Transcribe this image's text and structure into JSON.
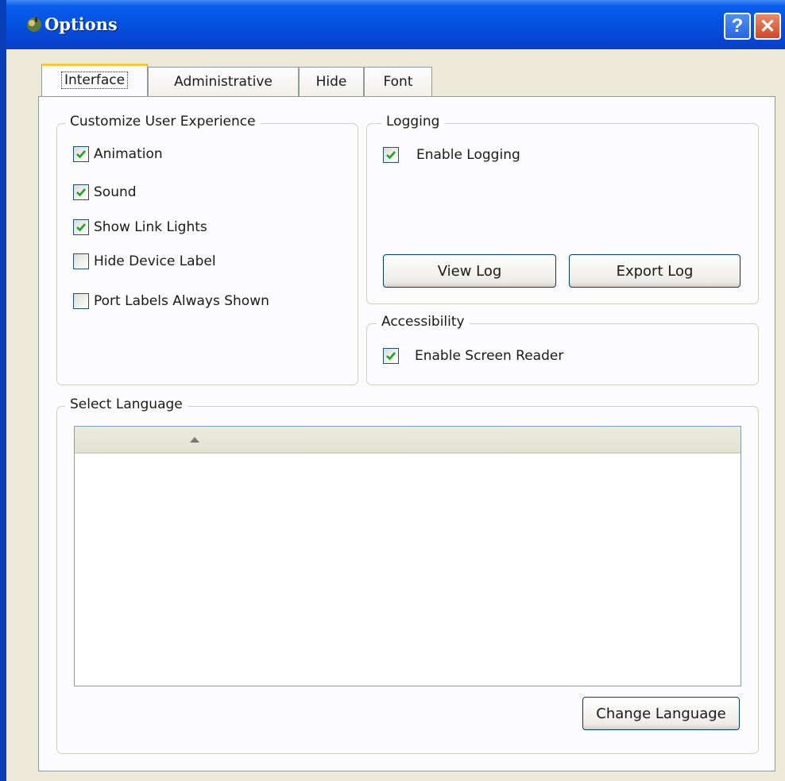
{
  "window": {
    "title": "Options",
    "help_label": "?",
    "close_label": "✕"
  },
  "tabs": [
    {
      "label": "Interface",
      "active": true
    },
    {
      "label": "Administrative"
    },
    {
      "label": "Hide"
    },
    {
      "label": "Font"
    }
  ],
  "customize": {
    "title": "Customize User Experience",
    "items": [
      {
        "label": "Animation",
        "checked": true
      },
      {
        "label": "Sound",
        "checked": true
      },
      {
        "label": "Show Link Lights",
        "checked": true
      },
      {
        "label": "Hide Device Label",
        "checked": false
      },
      {
        "label": "Port Labels Always Shown",
        "checked": false
      }
    ]
  },
  "logging": {
    "title": "Logging",
    "enable_label": "Enable Logging",
    "enable_checked": true,
    "view_log_label": "View Log",
    "export_log_label": "Export Log"
  },
  "accessibility": {
    "title": "Accessibility",
    "screen_reader_label": "Enable Screen Reader",
    "screen_reader_checked": true
  },
  "language": {
    "title": "Select Language",
    "change_button_label": "Change Language"
  },
  "colors": {
    "titlebar": "#0552e0",
    "window_border": "#0a3db8",
    "active_tab_highlight": "#ffc83c",
    "checkmark": "#21a121"
  }
}
